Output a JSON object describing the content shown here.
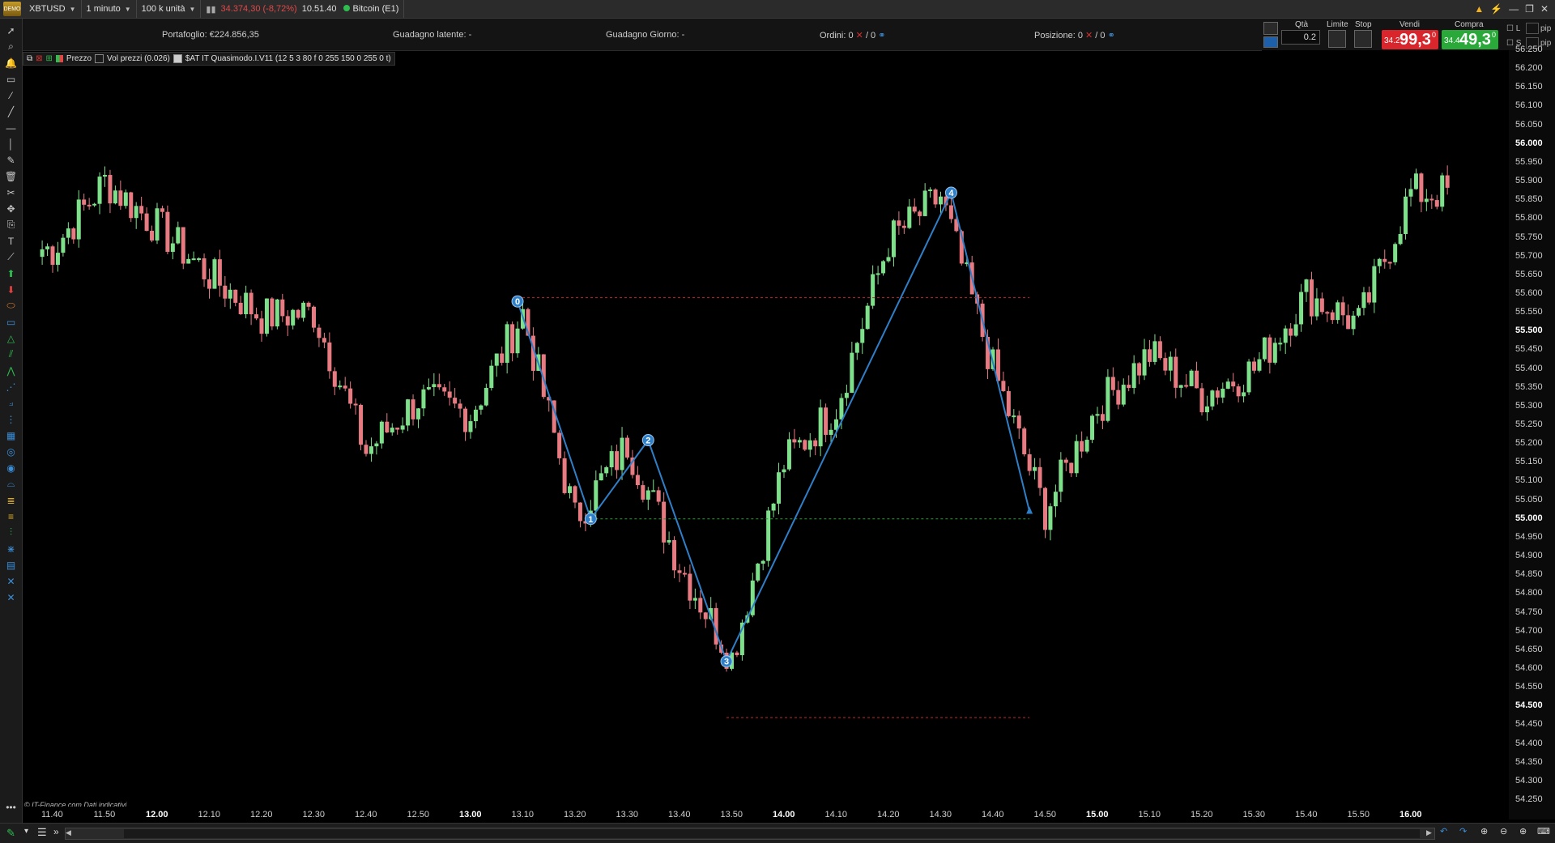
{
  "titlebar": {
    "demo_badge": "DEMO",
    "symbol": "XBTUSD",
    "timeframe": "1 minuto",
    "units": "100 k unità",
    "change": "34.374,30 (-8,72%)",
    "time": "10.51.40",
    "instrument": "Bitcoin (E1)",
    "window_controls": [
      "▲",
      "⚡",
      "—",
      "❐",
      "✕"
    ]
  },
  "infobar": {
    "portfolio_label": "Portafoglio:",
    "portfolio_value": "€224.856,35",
    "unrealized_label": "Guadagno latente:",
    "unrealized_value": "-",
    "daily_label": "Guadagno Giorno:",
    "daily_value": "-",
    "orders_label": "Ordini:",
    "orders_a": "0",
    "orders_b": "/ 0",
    "position_label": "Posizione:",
    "position_a": "0",
    "position_b": "/ 0"
  },
  "trade_panel": {
    "qty_label": "Qtà",
    "qty_value": "0.2",
    "limit_label": "Limite",
    "stop_label": "Stop",
    "sell_label": "Vendi",
    "buy_label": "Compra",
    "sell_small": "34.2",
    "sell_big": "99,3",
    "sell_sup": "0",
    "buy_small": "34.4",
    "buy_big": "49,3",
    "buy_sup": "0",
    "l_label": "L",
    "s_label": "S",
    "pip_label": "pip"
  },
  "indicators": {
    "price": "Prezzo",
    "volume": "Vol prezzi (0.026)",
    "custom": "$AT IT Quasimodo.I.V11 (12 5 3 80 f 0 255 150 0 255 0 t)"
  },
  "credit": "© IT-Finance.com  Dati indicativi",
  "price_axis": [
    {
      "v": "56.250",
      "b": false
    },
    {
      "v": "56.200",
      "b": false
    },
    {
      "v": "56.150",
      "b": false
    },
    {
      "v": "56.100",
      "b": false
    },
    {
      "v": "56.050",
      "b": false
    },
    {
      "v": "56.000",
      "b": true
    },
    {
      "v": "55.950",
      "b": false
    },
    {
      "v": "55.900",
      "b": false
    },
    {
      "v": "55.850",
      "b": false
    },
    {
      "v": "55.800",
      "b": false
    },
    {
      "v": "55.750",
      "b": false
    },
    {
      "v": "55.700",
      "b": false
    },
    {
      "v": "55.650",
      "b": false
    },
    {
      "v": "55.600",
      "b": false
    },
    {
      "v": "55.550",
      "b": false
    },
    {
      "v": "55.500",
      "b": true
    },
    {
      "v": "55.450",
      "b": false
    },
    {
      "v": "55.400",
      "b": false
    },
    {
      "v": "55.350",
      "b": false
    },
    {
      "v": "55.300",
      "b": false
    },
    {
      "v": "55.250",
      "b": false
    },
    {
      "v": "55.200",
      "b": false
    },
    {
      "v": "55.150",
      "b": false
    },
    {
      "v": "55.100",
      "b": false
    },
    {
      "v": "55.050",
      "b": false
    },
    {
      "v": "55.000",
      "b": true
    },
    {
      "v": "54.950",
      "b": false
    },
    {
      "v": "54.900",
      "b": false
    },
    {
      "v": "54.850",
      "b": false
    },
    {
      "v": "54.800",
      "b": false
    },
    {
      "v": "54.750",
      "b": false
    },
    {
      "v": "54.700",
      "b": false
    },
    {
      "v": "54.650",
      "b": false
    },
    {
      "v": "54.600",
      "b": false
    },
    {
      "v": "54.550",
      "b": false
    },
    {
      "v": "54.500",
      "b": true
    },
    {
      "v": "54.450",
      "b": false
    },
    {
      "v": "54.400",
      "b": false
    },
    {
      "v": "54.350",
      "b": false
    },
    {
      "v": "54.300",
      "b": false
    },
    {
      "v": "54.250",
      "b": false
    }
  ],
  "time_axis": [
    {
      "t": "11.40",
      "b": false
    },
    {
      "t": "11.50",
      "b": false
    },
    {
      "t": "12.00",
      "b": true
    },
    {
      "t": "12.10",
      "b": false
    },
    {
      "t": "12.20",
      "b": false
    },
    {
      "t": "12.30",
      "b": false
    },
    {
      "t": "12.40",
      "b": false
    },
    {
      "t": "12.50",
      "b": false
    },
    {
      "t": "13.00",
      "b": true
    },
    {
      "t": "13.10",
      "b": false
    },
    {
      "t": "13.20",
      "b": false
    },
    {
      "t": "13.30",
      "b": false
    },
    {
      "t": "13.40",
      "b": false
    },
    {
      "t": "13.50",
      "b": false
    },
    {
      "t": "14.00",
      "b": true
    },
    {
      "t": "14.10",
      "b": false
    },
    {
      "t": "14.20",
      "b": false
    },
    {
      "t": "14.30",
      "b": false
    },
    {
      "t": "14.40",
      "b": false
    },
    {
      "t": "14.50",
      "b": false
    },
    {
      "t": "15.00",
      "b": true
    },
    {
      "t": "15.10",
      "b": false
    },
    {
      "t": "15.20",
      "b": false
    },
    {
      "t": "15.30",
      "b": false
    },
    {
      "t": "15.40",
      "b": false
    },
    {
      "t": "15.50",
      "b": false
    },
    {
      "t": "16.00",
      "b": true
    }
  ],
  "colors": {
    "up": "#7ee08a",
    "down": "#e87a82",
    "pattern": "#2f7fc8",
    "support": "#2f9a3a",
    "resistance": "#c02a2a"
  },
  "chart_data": {
    "type": "candlestick",
    "symbol": "XBTUSD",
    "interval": "1 minute",
    "ylim": [
      54220,
      56280
    ],
    "close_anchors_per_10min": [
      {
        "t": "11.40",
        "c": 55720
      },
      {
        "t": "11.50",
        "c": 55900
      },
      {
        "t": "12.00",
        "c": 55780
      },
      {
        "t": "12.10",
        "c": 55650
      },
      {
        "t": "12.20",
        "c": 55540
      },
      {
        "t": "12.30",
        "c": 55550
      },
      {
        "t": "12.40",
        "c": 55180
      },
      {
        "t": "12.50",
        "c": 55320
      },
      {
        "t": "13.00",
        "c": 55280
      },
      {
        "t": "13.10",
        "c": 55550
      },
      {
        "t": "13.20",
        "c": 55000
      },
      {
        "t": "13.30",
        "c": 55200
      },
      {
        "t": "13.40",
        "c": 54880
      },
      {
        "t": "13.50",
        "c": 54630
      },
      {
        "t": "14.00",
        "c": 55150
      },
      {
        "t": "14.10",
        "c": 55300
      },
      {
        "t": "14.20",
        "c": 55740
      },
      {
        "t": "14.30",
        "c": 55860
      },
      {
        "t": "14.40",
        "c": 55400
      },
      {
        "t": "14.50",
        "c": 55020
      },
      {
        "t": "15.00",
        "c": 55300
      },
      {
        "t": "15.10",
        "c": 55440
      },
      {
        "t": "15.20",
        "c": 55330
      },
      {
        "t": "15.30",
        "c": 55400
      },
      {
        "t": "15.40",
        "c": 55600
      },
      {
        "t": "15.50",
        "c": 55520
      },
      {
        "t": "16.00",
        "c": 55870
      }
    ],
    "pattern": {
      "name": "Quasimodo",
      "points": [
        {
          "label": "0",
          "t": "13.09",
          "price": 55580
        },
        {
          "label": "1",
          "t": "13.23",
          "price": 55000
        },
        {
          "label": "2",
          "t": "13.34",
          "price": 55210
        },
        {
          "label": "3",
          "t": "13.49",
          "price": 54620
        },
        {
          "label": "4",
          "t": "14.32",
          "price": 55870
        },
        {
          "label": "",
          "t": "14.47",
          "price": 55020
        }
      ],
      "lines": [
        {
          "kind": "resistance",
          "from": "13.09",
          "to": "14.47",
          "price": 55590
        },
        {
          "kind": "support",
          "from": "13.23",
          "to": "14.47",
          "price": 55000
        },
        {
          "kind": "resistance",
          "from": "13.49",
          "to": "14.47",
          "price": 54470
        }
      ]
    }
  }
}
